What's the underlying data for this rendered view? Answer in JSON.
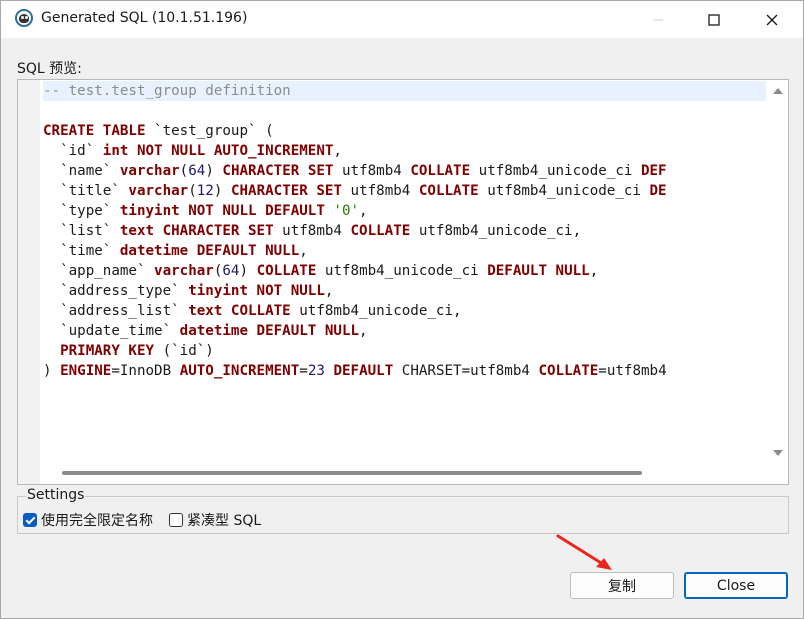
{
  "window": {
    "title": "Generated SQL (10.1.51.196)",
    "icon": "app-logo-icon",
    "controls": [
      "minimize-icon",
      "maximize-icon",
      "close-icon"
    ]
  },
  "sql_label": "SQL 预览:",
  "code_lines": [
    [
      {
        "c": "cmt",
        "t": "-- test.test_group definition"
      }
    ],
    [],
    [
      {
        "c": "kw",
        "t": "CREATE TABLE"
      },
      {
        "c": "plain",
        "t": " `test_group` ("
      }
    ],
    [
      {
        "c": "plain",
        "t": "  `id` "
      },
      {
        "c": "kw",
        "t": "int NOT NULL AUTO_INCREMENT"
      },
      {
        "c": "plain",
        "t": ","
      }
    ],
    [
      {
        "c": "plain",
        "t": "  `name` "
      },
      {
        "c": "kw",
        "t": "varchar"
      },
      {
        "c": "plain",
        "t": "("
      },
      {
        "c": "num",
        "t": "64"
      },
      {
        "c": "plain",
        "t": ") "
      },
      {
        "c": "kw",
        "t": "CHARACTER SET"
      },
      {
        "c": "plain",
        "t": " utf8mb4 "
      },
      {
        "c": "kw",
        "t": "COLLATE"
      },
      {
        "c": "plain",
        "t": " utf8mb4_unicode_ci "
      },
      {
        "c": "kw",
        "t": "DEF"
      }
    ],
    [
      {
        "c": "plain",
        "t": "  `title` "
      },
      {
        "c": "kw",
        "t": "varchar"
      },
      {
        "c": "plain",
        "t": "("
      },
      {
        "c": "num",
        "t": "12"
      },
      {
        "c": "plain",
        "t": ") "
      },
      {
        "c": "kw",
        "t": "CHARACTER SET"
      },
      {
        "c": "plain",
        "t": " utf8mb4 "
      },
      {
        "c": "kw",
        "t": "COLLATE"
      },
      {
        "c": "plain",
        "t": " utf8mb4_unicode_ci "
      },
      {
        "c": "kw",
        "t": "DE"
      }
    ],
    [
      {
        "c": "plain",
        "t": "  `type` "
      },
      {
        "c": "kw",
        "t": "tinyint NOT NULL DEFAULT"
      },
      {
        "c": "plain",
        "t": " "
      },
      {
        "c": "str",
        "t": "'0'"
      },
      {
        "c": "plain",
        "t": ","
      }
    ],
    [
      {
        "c": "plain",
        "t": "  `list` "
      },
      {
        "c": "kw",
        "t": "text CHARACTER SET"
      },
      {
        "c": "plain",
        "t": " utf8mb4 "
      },
      {
        "c": "kw",
        "t": "COLLATE"
      },
      {
        "c": "plain",
        "t": " utf8mb4_unicode_ci,"
      }
    ],
    [
      {
        "c": "plain",
        "t": "  `time` "
      },
      {
        "c": "kw",
        "t": "datetime DEFAULT NULL"
      },
      {
        "c": "plain",
        "t": ","
      }
    ],
    [
      {
        "c": "plain",
        "t": "  `app_name` "
      },
      {
        "c": "kw",
        "t": "varchar"
      },
      {
        "c": "plain",
        "t": "("
      },
      {
        "c": "num",
        "t": "64"
      },
      {
        "c": "plain",
        "t": ") "
      },
      {
        "c": "kw",
        "t": "COLLATE"
      },
      {
        "c": "plain",
        "t": " utf8mb4_unicode_ci "
      },
      {
        "c": "kw",
        "t": "DEFAULT NULL"
      },
      {
        "c": "plain",
        "t": ","
      }
    ],
    [
      {
        "c": "plain",
        "t": "  `address_type` "
      },
      {
        "c": "kw",
        "t": "tinyint NOT NULL"
      },
      {
        "c": "plain",
        "t": ","
      }
    ],
    [
      {
        "c": "plain",
        "t": "  `address_list` "
      },
      {
        "c": "kw",
        "t": "text COLLATE"
      },
      {
        "c": "plain",
        "t": " utf8mb4_unicode_ci,"
      }
    ],
    [
      {
        "c": "plain",
        "t": "  `update_time` "
      },
      {
        "c": "kw",
        "t": "datetime DEFAULT NULL"
      },
      {
        "c": "plain",
        "t": ","
      }
    ],
    [
      {
        "c": "plain",
        "t": "  "
      },
      {
        "c": "kw",
        "t": "PRIMARY KEY"
      },
      {
        "c": "plain",
        "t": " (`id`)"
      }
    ],
    [
      {
        "c": "plain",
        "t": ") "
      },
      {
        "c": "kw",
        "t": "ENGINE"
      },
      {
        "c": "plain",
        "t": "=InnoDB "
      },
      {
        "c": "kw",
        "t": "AUTO_INCREMENT"
      },
      {
        "c": "plain",
        "t": "="
      },
      {
        "c": "num",
        "t": "23"
      },
      {
        "c": "plain",
        "t": " "
      },
      {
        "c": "kw",
        "t": "DEFAULT"
      },
      {
        "c": "plain",
        "t": " CHARSET=utf8mb4 "
      },
      {
        "c": "kw",
        "t": "COLLATE"
      },
      {
        "c": "plain",
        "t": "=utf8mb4"
      }
    ]
  ],
  "settings": {
    "legend": "Settings",
    "options": [
      {
        "label": "使用完全限定名称",
        "checked": true
      },
      {
        "label": "紧凑型 SQL",
        "checked": false
      }
    ]
  },
  "buttons": {
    "copy": "复制",
    "close": "Close"
  },
  "colors": {
    "keyword": "#7f0000",
    "comment": "#8c8c8c",
    "number": "#1a1a6e",
    "string": "#2a7a00",
    "current_line": "#e8f2fe",
    "annotation_arrow": "#e8281e"
  }
}
